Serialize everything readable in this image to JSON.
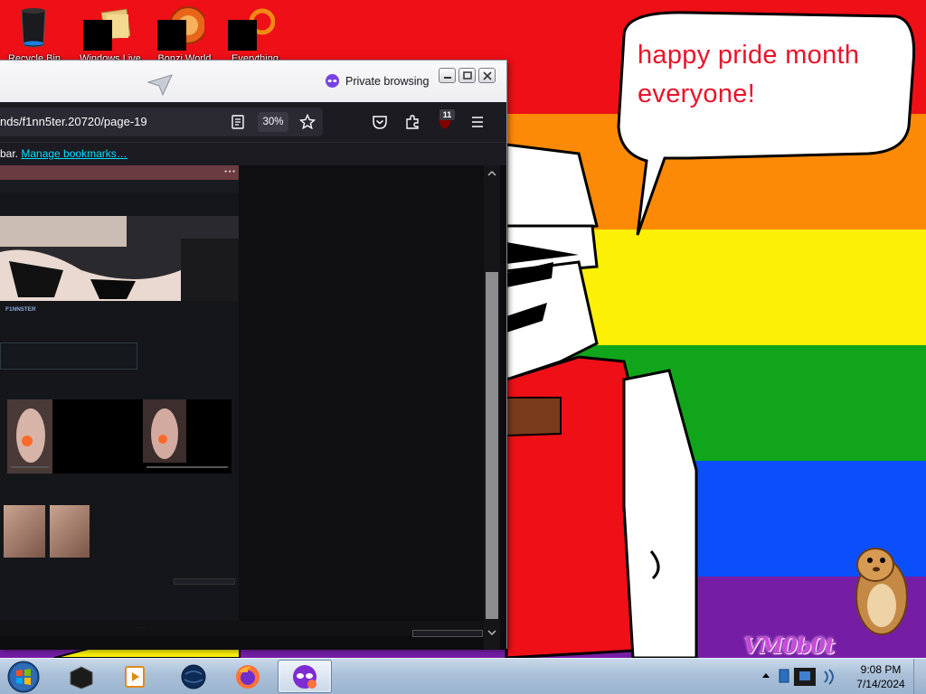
{
  "desktop": {
    "wallpaper": {
      "bubble_text": "happy pride month everyone!",
      "watermark": "VM0b0t",
      "colors": {
        "red": "#ee0f17",
        "orange": "#fc8a07",
        "yellow": "#fbf006",
        "green": "#10a51a",
        "blue": "#0a4ffb",
        "purple": "#751ea5"
      }
    },
    "icons": [
      {
        "label": "Recycle Bin",
        "icon": "recycle-bin-icon"
      },
      {
        "label": "Windows Live",
        "icon": "windows-live-icon"
      },
      {
        "label": "Bonzi World",
        "icon": "bonzi-world-icon"
      },
      {
        "label": "Everything",
        "icon": "everything-search-icon"
      }
    ]
  },
  "browser": {
    "title": "Private browsing",
    "url": "nds/f1nn5ter.20720/page-19",
    "zoom": "30%",
    "extension_badge": "11",
    "bookmarks_bar": {
      "prefix": "bar.",
      "link": "Manage bookmarks…"
    },
    "page": {
      "username": "F1NN5TER"
    }
  },
  "taskbar": {
    "items": [
      {
        "name": "start",
        "icon": "windows-start-icon"
      },
      {
        "name": "vm-app",
        "icon": "black-cube-icon"
      },
      {
        "name": "media-player",
        "icon": "media-player-icon"
      },
      {
        "name": "dark-globe",
        "icon": "globe-icon"
      },
      {
        "name": "firefox",
        "icon": "firefox-icon"
      },
      {
        "name": "firefox-private",
        "icon": "private-browsing-icon"
      }
    ],
    "clock": {
      "time": "9:08 PM",
      "date": "7/14/2024"
    }
  }
}
